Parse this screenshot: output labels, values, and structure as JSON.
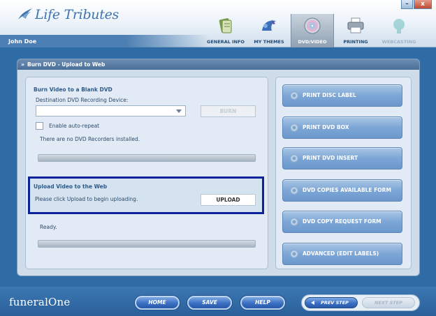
{
  "window": {
    "minimize": "–",
    "close": "x"
  },
  "header": {
    "logo_text": "Life Tributes",
    "user_name": "John Doe",
    "nav": [
      {
        "label": "GENERAL INFO",
        "icon": "document-icon",
        "state": "normal"
      },
      {
        "label": "MY THEMES",
        "icon": "themes-icon",
        "state": "normal"
      },
      {
        "label": "DVD/VIDEO",
        "icon": "dvd-disc-icon",
        "state": "active"
      },
      {
        "label": "PRINTING",
        "icon": "printer-icon",
        "state": "normal"
      },
      {
        "label": "WEBCASTING",
        "icon": "webcast-icon",
        "state": "disabled"
      }
    ]
  },
  "main": {
    "title": "Burn DVD - Upload to Web",
    "burn": {
      "heading": "Burn Video to a Blank DVD",
      "device_label": "Destination DVD Recording Device:",
      "device_value": "",
      "burn_button": "BURN",
      "auto_repeat_label": "Enable auto-repeat",
      "status": "There are no DVD Recorders installed."
    },
    "upload": {
      "heading": "Upload Video to the Web",
      "instruction": "Please click Upload to begin uploading.",
      "upload_button": "UPLOAD",
      "status": "Ready."
    },
    "right_buttons": [
      "PRINT DISC LABEL",
      "PRINT DVD BOX",
      "PRINT DVD INSERT",
      "DVD COPIES AVAILABLE FORM",
      "DVD COPY REQUEST FORM",
      "ADVANCED (EDIT LABELS)"
    ]
  },
  "footer": {
    "brand": "funeralOne",
    "home": "HOME",
    "save": "SAVE",
    "help": "HELP",
    "prev_step": "PREV STEP",
    "next_step": "NEXT STEP"
  },
  "colors": {
    "accent": "#2f6ca6",
    "highlight_border": "#0c2299",
    "title_text": "#2c5a8c"
  }
}
